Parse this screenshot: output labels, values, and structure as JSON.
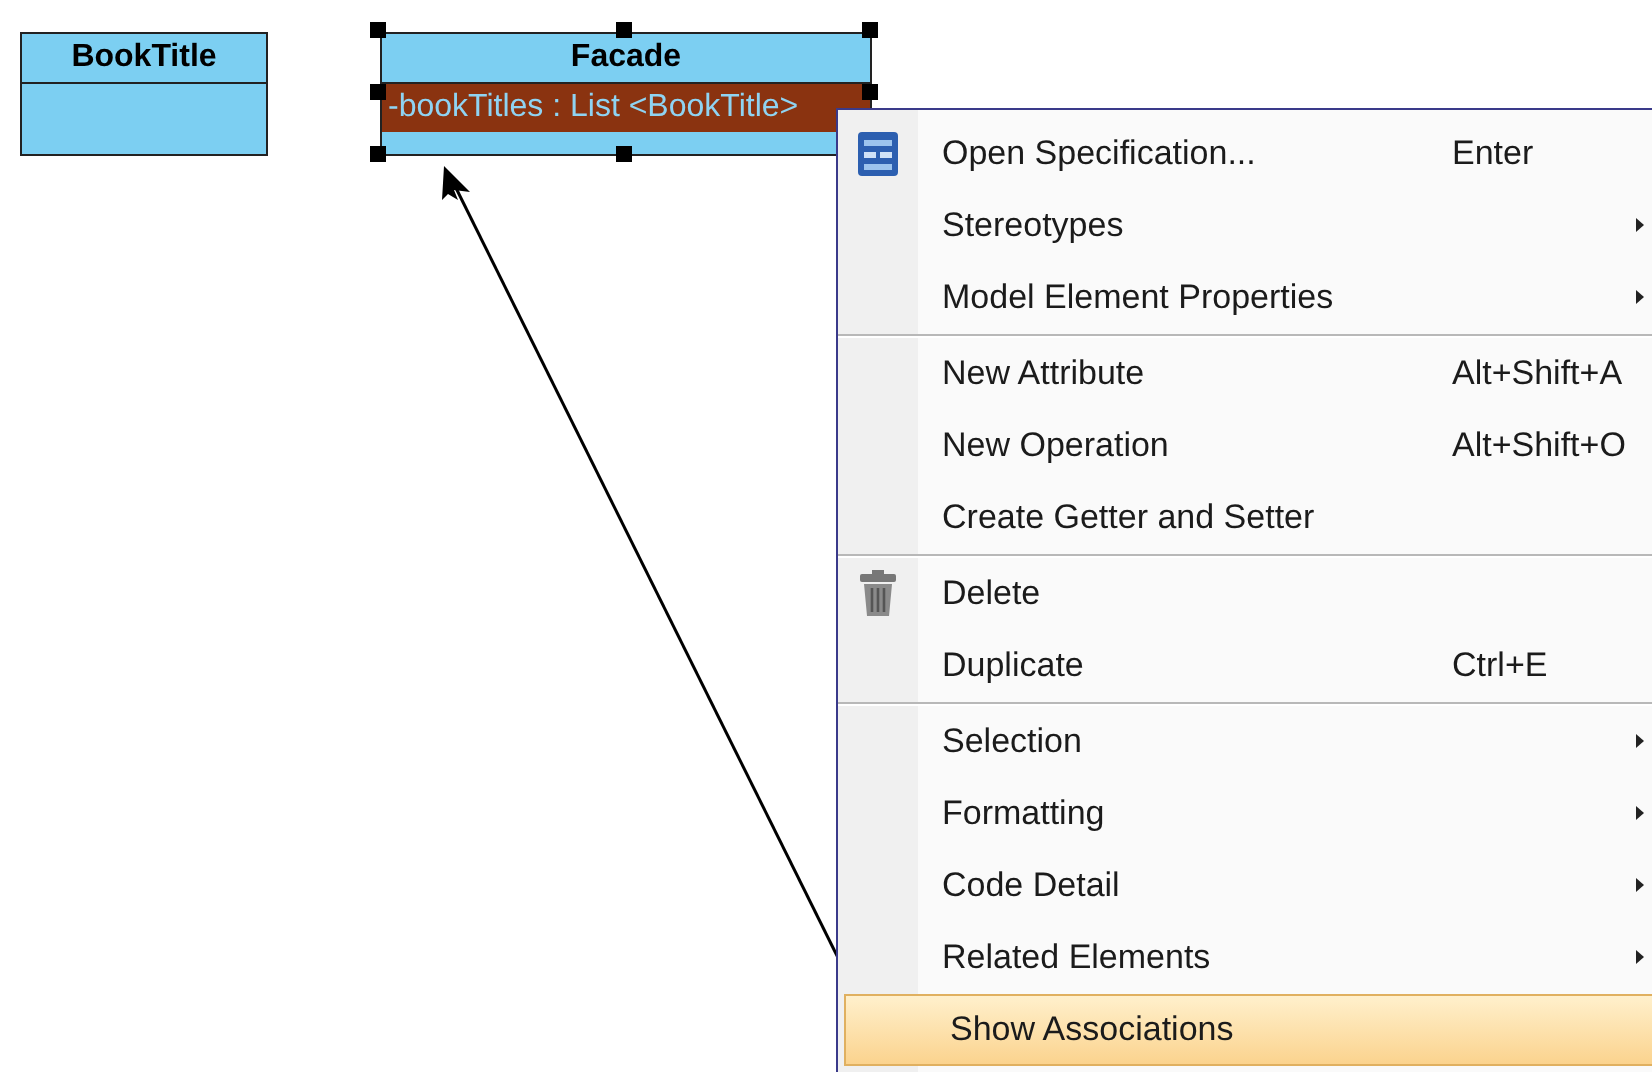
{
  "diagram": {
    "classes": [
      {
        "name": "BookTitle",
        "selected": false
      },
      {
        "name": "Facade",
        "selected": true,
        "attributes": [
          {
            "text": "-bookTitles : List <BookTitle>",
            "selected": true
          }
        ]
      }
    ]
  },
  "context_menu": {
    "groups": [
      [
        {
          "kind": "spec",
          "label": "Open Specification...",
          "shortcut": "Enter",
          "submenu": false,
          "selected": false
        },
        {
          "label": "Stereotypes",
          "submenu": true,
          "selected": false
        },
        {
          "label": "Model Element Properties",
          "submenu": true,
          "selected": false
        }
      ],
      [
        {
          "label": "New Attribute",
          "shortcut": "Alt+Shift+A",
          "submenu": false,
          "selected": false
        },
        {
          "label": "New Operation",
          "shortcut": "Alt+Shift+O",
          "submenu": false,
          "selected": false
        },
        {
          "label": "Create Getter and Setter",
          "submenu": false,
          "selected": false
        }
      ],
      [
        {
          "kind": "trash",
          "label": "Delete",
          "submenu": false,
          "selected": false
        },
        {
          "label": "Duplicate",
          "shortcut": "Ctrl+E",
          "submenu": false,
          "selected": false
        }
      ],
      [
        {
          "label": "Selection",
          "submenu": true,
          "selected": false
        },
        {
          "label": "Formatting",
          "submenu": true,
          "selected": false
        },
        {
          "label": "Code Detail",
          "submenu": true,
          "selected": false
        },
        {
          "label": "Related Elements",
          "submenu": true,
          "selected": false
        },
        {
          "label": "Show Associations",
          "submenu": false,
          "selected": true
        }
      ]
    ]
  }
}
